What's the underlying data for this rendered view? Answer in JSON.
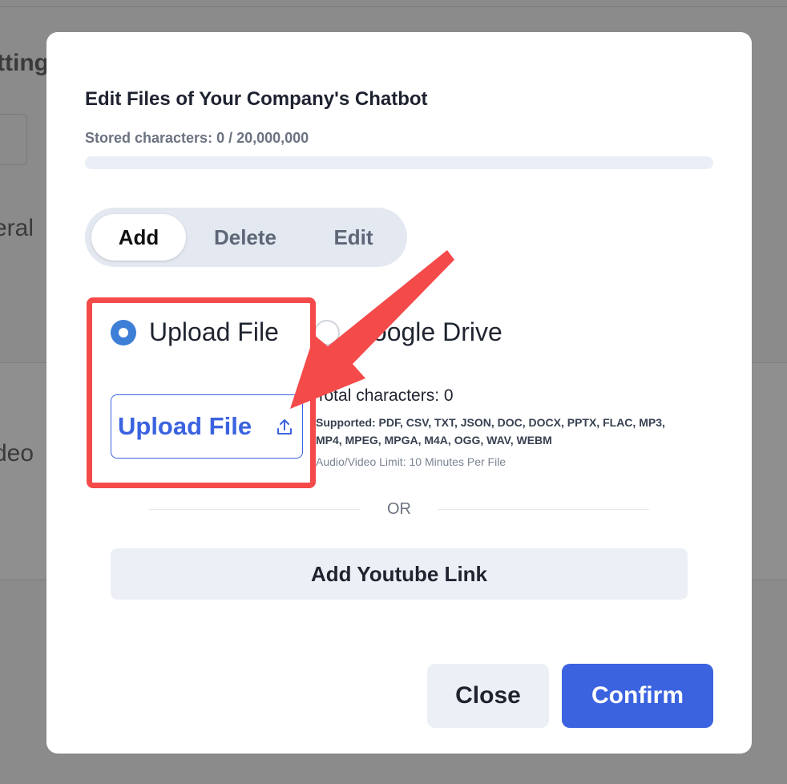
{
  "background": {
    "fragment_top": "tting",
    "fragment_middle": "eral",
    "fragment_bottom": "deo"
  },
  "modal": {
    "title": "Edit Files of Your Company's Chatbot",
    "stored_characters": "Stored characters: 0 / 20,000,000",
    "storage_progress_percent": 0,
    "tabs": [
      {
        "label": "Add",
        "active": true
      },
      {
        "label": "Delete",
        "active": false
      },
      {
        "label": "Edit",
        "active": false
      }
    ],
    "source_options": [
      {
        "label": "Upload File",
        "selected": true
      },
      {
        "label": "Google Drive",
        "selected": false
      }
    ],
    "upload_button_label": "Upload File",
    "total_characters": "Total characters: 0",
    "supported_formats": "Supported: PDF, CSV, TXT, JSON, DOC, DOCX, PPTX, FLAC, MP3, MP4, MPEG, MPGA, M4A, OGG, WAV, WEBM",
    "limit_note": "Audio/Video Limit: 10 Minutes Per File",
    "or_divider": "OR",
    "youtube_button_label": "Add Youtube Link",
    "close_button_label": "Close",
    "confirm_button_label": "Confirm"
  },
  "colors": {
    "accent": "#3b63e0",
    "annotation": "#f44a4a",
    "radio_selected": "#3d7fd6",
    "overlay": "#8b8b8b"
  },
  "icons": {
    "upload": "upload-icon",
    "caret": "chevron-down-icon"
  }
}
